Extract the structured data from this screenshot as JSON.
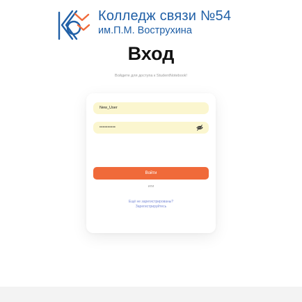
{
  "header": {
    "college_name": "Колледж связи №54",
    "college_sub": "им.П.М. Вострухина"
  },
  "login": {
    "title": "Вход",
    "subtitle": "Войдите для доступа к StudentNotebook!",
    "login_value": "New_User",
    "password_value": "••••••••••",
    "submit_label": "Войти",
    "or_label": "или",
    "register_question": "Ещё не зарегистрированы?",
    "register_link": "Зарегистрируйтесь"
  },
  "colors": {
    "brand_blue": "#1f5fa6",
    "accent_orange": "#f06a3a",
    "field_bg": "#fbf6cf",
    "link": "#7a8bd6"
  },
  "icons": {
    "logo": "college-logo-icon",
    "password_toggle": "eye-off-icon"
  }
}
